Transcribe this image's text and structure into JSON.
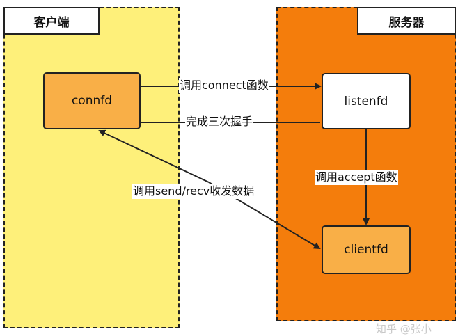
{
  "panels": {
    "client": {
      "title": "客户端"
    },
    "server": {
      "title": "服务器"
    }
  },
  "nodes": {
    "connfd": "connfd",
    "listenfd": "listenfd",
    "clientfd": "clientfd"
  },
  "edges": {
    "connect": "调用connect函数",
    "handshake": "完成三次握手",
    "accept": "调用accept函数",
    "sendrecv": "调用send/recv收发数据"
  },
  "watermark": "知乎 @张小",
  "colors": {
    "client_panel": "#fef07a",
    "server_panel": "#f47d0c",
    "node_fill_orange": "#f9af47",
    "node_fill_white": "#ffffff",
    "line": "#222222"
  }
}
